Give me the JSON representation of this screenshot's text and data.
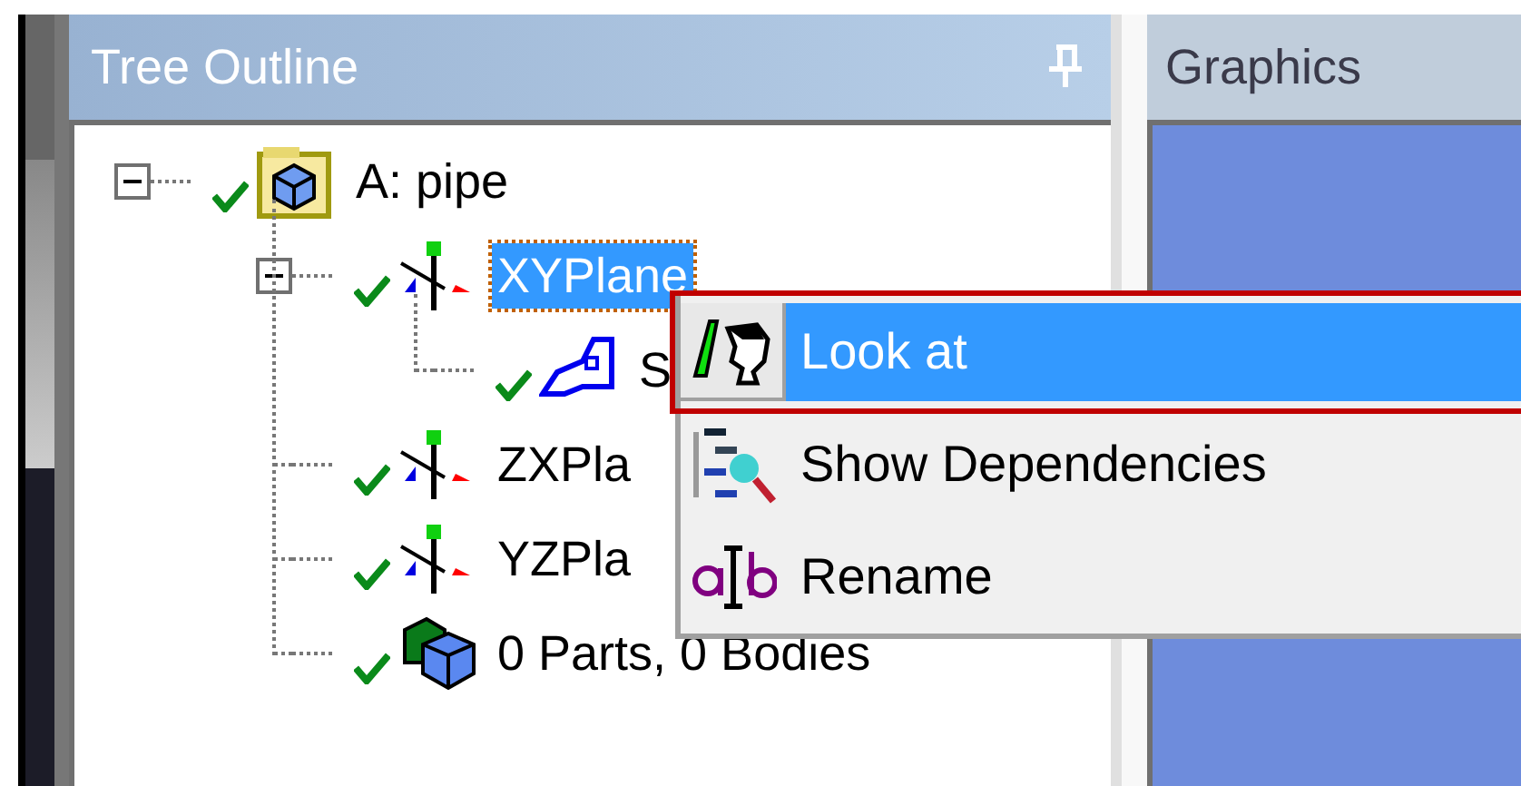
{
  "tree_panel": {
    "title": "Tree Outline"
  },
  "tree": [
    {
      "label": "A: pipe",
      "kind": "model",
      "expanded": true,
      "selected": false,
      "checked": true,
      "children": [
        {
          "label": "XYPlane",
          "kind": "plane",
          "expanded": true,
          "selected": true,
          "checked": true,
          "children": [
            {
              "label": "S",
              "kind": "sketch",
              "selected": false,
              "checked": true
            }
          ]
        },
        {
          "label": "ZXPla",
          "kind": "plane",
          "selected": false,
          "checked": true
        },
        {
          "label": "YZPla",
          "kind": "plane",
          "selected": false,
          "checked": true
        },
        {
          "label": "0 Parts, 0 Bodies",
          "kind": "parts",
          "selected": false,
          "checked": true
        }
      ]
    }
  ],
  "graphics_panel": {
    "title": "Graphics"
  },
  "context_menu": {
    "items": [
      {
        "label": "Look at",
        "kind": "look",
        "selected": true
      },
      {
        "label": "Show Dependencies",
        "kind": "dependencies",
        "selected": false
      },
      {
        "label": "Rename",
        "kind": "rename",
        "selected": false
      }
    ]
  }
}
